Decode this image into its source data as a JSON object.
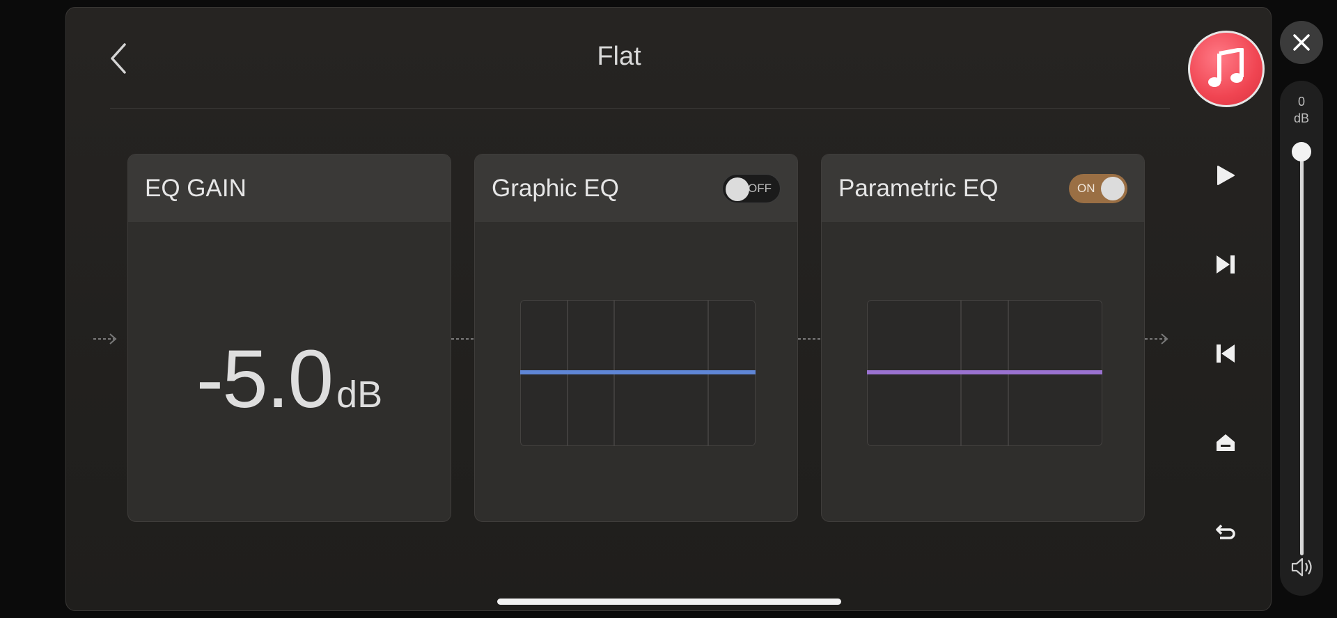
{
  "header": {
    "title": "Flat"
  },
  "cards": [
    {
      "title": "EQ GAIN",
      "value": "-5.0",
      "unit": "dB"
    },
    {
      "title": "Graphic EQ",
      "toggle_state": "OFF",
      "line_color": "#5f86d6"
    },
    {
      "title": "Parametric EQ",
      "toggle_state": "ON",
      "line_color": "#9a72d0"
    }
  ],
  "volume": {
    "value_label": "0",
    "unit_label": "dB",
    "level_fraction": 1.0
  },
  "colors": {
    "accent_toggle_on": "#9a6f44",
    "music_badge": "#f04552"
  },
  "icons": {
    "back": "chevron-left-icon",
    "music": "music-note-icon",
    "close": "close-icon",
    "play": "play-icon",
    "next": "skip-next-icon",
    "previous": "skip-previous-icon",
    "home": "home-icon",
    "return": "return-icon",
    "volume": "speaker-icon"
  }
}
